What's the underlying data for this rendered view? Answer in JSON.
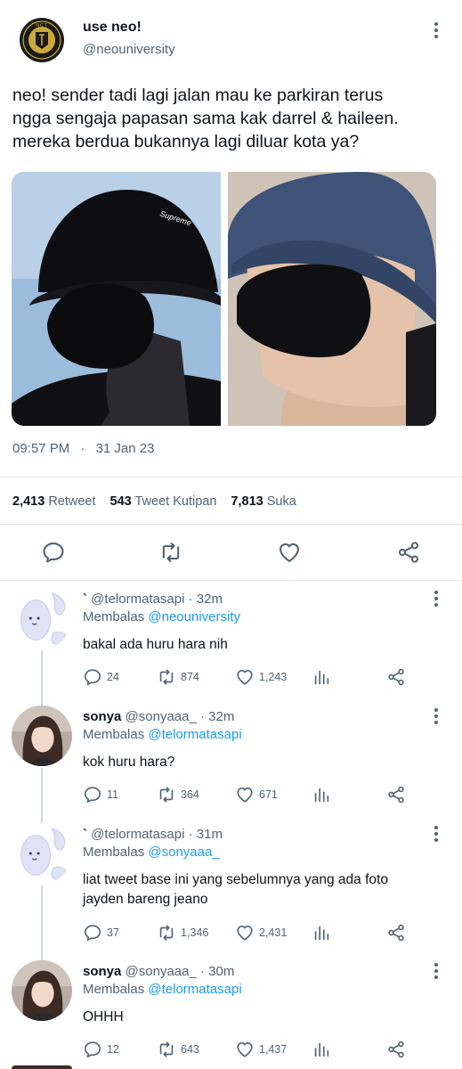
{
  "main_tweet": {
    "display_name": "use neo!",
    "handle": "@neouniversity",
    "avatar_text": "NCT",
    "text_lines": [
      "neo! sender tadi lagi jalan mau ke parkiran terus",
      "ngga sengaja papasan sama kak darrel & haileen.",
      "mereka berdua bukannya lagi diluar kota ya?"
    ],
    "photo_left_label": "Supreme",
    "time": "09:57 PM",
    "date": "31 Jan 23",
    "stats": {
      "retweets": "2,413",
      "retweets_label": "Retweet",
      "quotes": "543",
      "quotes_label": "Tweet Kutipan",
      "likes": "7,813",
      "likes_label": "Suka"
    }
  },
  "replies": [
    {
      "name": "`",
      "handle": "@telormatasapi",
      "time": "· 32m",
      "replying_label": "Membalas",
      "replying_to": "@neouniversity",
      "text_lines": [
        "bakal ada huru hara nih"
      ],
      "replies": "24",
      "retweets": "874",
      "likes": "1,243"
    },
    {
      "name": "sonya",
      "handle": "@sonyaaa_",
      "time": "· 32m",
      "replying_label": "Membalas",
      "replying_to": "@telormatasapi",
      "text_lines": [
        "kok huru hara?"
      ],
      "replies": "11",
      "retweets": "364",
      "likes": "671"
    },
    {
      "name": "`",
      "handle": "@telormatasapi",
      "time": "· 31m",
      "replying_label": "Membalas",
      "replying_to": "@sonyaaa_",
      "text_lines": [
        "liat tweet base ini yang sebelumnya yang ada foto",
        "jayden bareng jeano"
      ],
      "replies": "37",
      "retweets": "1,346",
      "likes": "2,431"
    },
    {
      "name": "sonya",
      "handle": "@sonyaaa_",
      "time": "· 30m",
      "replying_label": "Membalas",
      "replying_to": "@telormatasapi",
      "text_lines": [
        "OHHH"
      ],
      "replies": "12",
      "retweets": "643",
      "likes": "1,437"
    }
  ],
  "colors": {
    "accent": "#1d9bf0",
    "muted": "#536471",
    "text": "#0f1419",
    "bean_avatar": "#dfe3f5"
  }
}
